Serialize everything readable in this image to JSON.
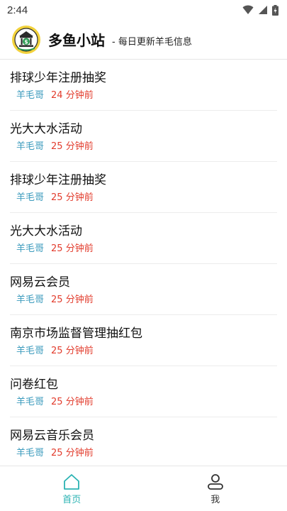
{
  "status_bar": {
    "time": "2:44"
  },
  "header": {
    "title": "多鱼小站",
    "subtitle": "- 每日更新羊毛信息"
  },
  "feed": {
    "items": [
      {
        "title": "排球少年注册抽奖",
        "author": "羊毛哥",
        "time": "24 分钟前"
      },
      {
        "title": "光大大水活动",
        "author": "羊毛哥",
        "time": "25 分钟前"
      },
      {
        "title": "排球少年注册抽奖",
        "author": "羊毛哥",
        "time": "25 分钟前"
      },
      {
        "title": "光大大水活动",
        "author": "羊毛哥",
        "time": "25 分钟前"
      },
      {
        "title": "网易云会员",
        "author": "羊毛哥",
        "time": "25 分钟前"
      },
      {
        "title": "南京市场监督管理抽红包",
        "author": "羊毛哥",
        "time": "25 分钟前"
      },
      {
        "title": "问卷红包",
        "author": "羊毛哥",
        "time": "25 分钟前"
      },
      {
        "title": "网易云音乐会员",
        "author": "羊毛哥",
        "time": "25 分钟前"
      }
    ]
  },
  "bottom_nav": {
    "tabs": [
      {
        "label": "首页",
        "icon": "home-icon",
        "active": true
      },
      {
        "label": "我",
        "icon": "user-icon",
        "active": false
      }
    ]
  },
  "colors": {
    "accent": "#2bb3b3",
    "author": "#3c9bbd",
    "time": "#e23c2d",
    "divider": "#ececec"
  }
}
